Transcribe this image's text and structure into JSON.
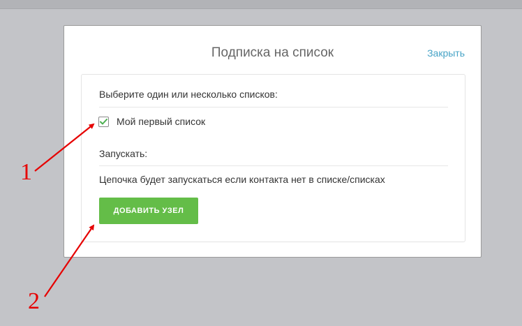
{
  "modal": {
    "title": "Подписка на список",
    "close_label": "Закрыть"
  },
  "lists": {
    "prompt": "Выберите один или несколько списков:",
    "items": [
      {
        "label": "Мой первый список",
        "checked": true
      }
    ]
  },
  "run": {
    "label": "Запускать:",
    "description": "Цепочка будет запускаться если контакта нет в списке/списках"
  },
  "actions": {
    "add_node_label": "ДОБАВИТЬ УЗЕЛ"
  },
  "annotations": {
    "marker_1": "1",
    "marker_2": "2"
  },
  "colors": {
    "accent_green": "#64bd48",
    "link_blue": "#46a3c6",
    "checkmark": "#4caf50",
    "annotation_red": "#e60000",
    "backdrop": "#c3c4c8"
  },
  "icons": {
    "checkbox": "check-icon",
    "annotation": "red-arrow-icon"
  }
}
